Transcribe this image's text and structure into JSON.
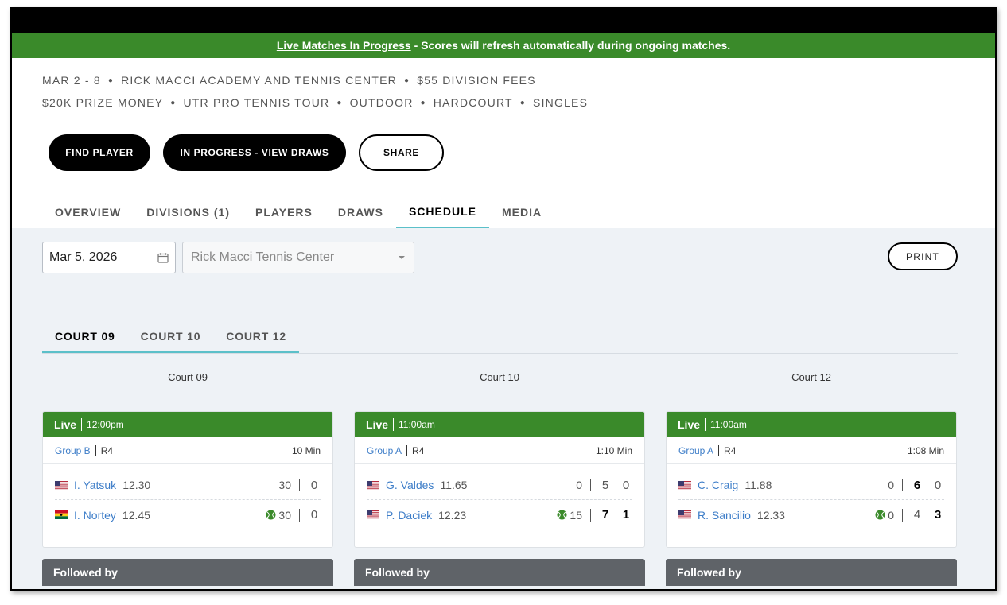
{
  "banner": {
    "link": "Live Matches In Progress",
    "text": "- Scores will refresh automatically during ongoing matches."
  },
  "meta": {
    "line1": [
      "MAR 2 - 8",
      "RICK MACCI ACADEMY AND TENNIS CENTER",
      "$55 DIVISION FEES"
    ],
    "line2": [
      "$20K PRIZE MONEY",
      "UTR PRO TENNIS TOUR",
      "OUTDOOR",
      "HARDCOURT",
      "SINGLES"
    ]
  },
  "buttons": {
    "find_player": "FIND PLAYER",
    "view_draws": "IN PROGRESS - VIEW DRAWS",
    "share": "SHARE"
  },
  "tabs": [
    "OVERVIEW",
    "DIVISIONS (1)",
    "PLAYERS",
    "DRAWS",
    "SCHEDULE",
    "MEDIA"
  ],
  "active_tab": "SCHEDULE",
  "filters": {
    "date": "Mar 5, 2026",
    "venue": "Rick Macci Tennis Center",
    "print": "PRINT"
  },
  "court_tabs": [
    "COURT 09",
    "COURT 10",
    "COURT 12"
  ],
  "courts": [
    {
      "title": "Court 09",
      "status": "Live",
      "time": "12:00pm",
      "group": "Group B",
      "round": "R4",
      "duration": "10 Min",
      "players": [
        {
          "flag": "us",
          "name": "I. Yatsuk",
          "rating": "12.30",
          "points": "30",
          "serving": false,
          "sets": [
            "0"
          ],
          "bold": [
            false
          ]
        },
        {
          "flag": "gh",
          "name": "I. Nortey",
          "rating": "12.45",
          "points": "30",
          "serving": true,
          "sets": [
            "0"
          ],
          "bold": [
            false
          ]
        }
      ],
      "followed": "Followed by"
    },
    {
      "title": "Court 10",
      "status": "Live",
      "time": "11:00am",
      "group": "Group A",
      "round": "R4",
      "duration": "1:10 Min",
      "players": [
        {
          "flag": "us",
          "name": "G. Valdes",
          "rating": "11.65",
          "points": "0",
          "serving": false,
          "sets": [
            "5",
            "0"
          ],
          "bold": [
            false,
            false
          ]
        },
        {
          "flag": "us",
          "name": "P. Daciek",
          "rating": "12.23",
          "points": "15",
          "serving": true,
          "sets": [
            "7",
            "1"
          ],
          "bold": [
            true,
            true
          ]
        }
      ],
      "followed": "Followed by"
    },
    {
      "title": "Court 12",
      "status": "Live",
      "time": "11:00am",
      "group": "Group A",
      "round": "R4",
      "duration": "1:08 Min",
      "players": [
        {
          "flag": "us",
          "name": "C. Craig",
          "rating": "11.88",
          "points": "0",
          "serving": false,
          "sets": [
            "6",
            "0"
          ],
          "bold": [
            true,
            false
          ]
        },
        {
          "flag": "us",
          "name": "R. Sancilio",
          "rating": "12.33",
          "points": "0",
          "serving": true,
          "sets": [
            "4",
            "3"
          ],
          "bold": [
            false,
            true
          ]
        }
      ],
      "followed": "Followed by"
    }
  ],
  "colors": {
    "live_green": "#3a8a2a",
    "link_blue": "#3d7dc8",
    "tab_accent": "#5bc0c9"
  }
}
